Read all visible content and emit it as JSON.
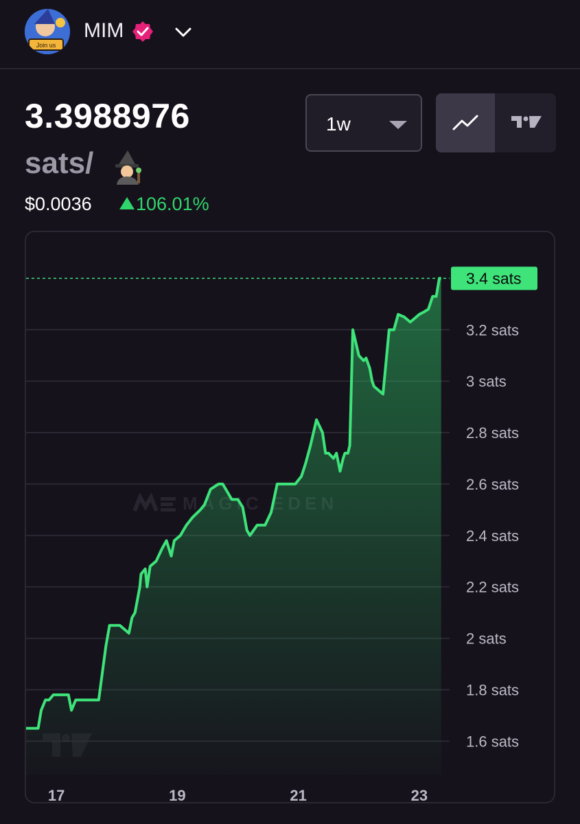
{
  "header": {
    "token_name": "MIM",
    "avatar_caption": "Join us",
    "verified_icon": "verified-badge-icon",
    "dropdown_icon": "chevron-down-icon"
  },
  "price": {
    "value": "3.3988976",
    "unit": "sats/",
    "unit_icon": "wizard-emoji-icon",
    "usd": "$0.0036",
    "change": "106.01%",
    "change_color": "#2fd66b"
  },
  "controls": {
    "timeframe": "1w",
    "line_view_icon": "line-chart-icon",
    "tradingview_icon": "tradingview-logo-icon"
  },
  "watermarks": {
    "magic_eden": "MAGIC EDEN",
    "tradingview": "TV"
  },
  "chart_data": {
    "type": "area",
    "ylim": [
      1.47,
      3.58
    ],
    "y_ticks": [
      {
        "value": 3.2,
        "label": "3.2 sats"
      },
      {
        "value": 3.0,
        "label": "3 sats"
      },
      {
        "value": 2.8,
        "label": "2.8 sats"
      },
      {
        "value": 2.6,
        "label": "2.6 sats"
      },
      {
        "value": 2.4,
        "label": "2.4 sats"
      },
      {
        "value": 2.2,
        "label": "2.2 sats"
      },
      {
        "value": 2.0,
        "label": "2 sats"
      },
      {
        "value": 1.8,
        "label": "1.8 sats"
      },
      {
        "value": 1.6,
        "label": "1.6 sats"
      }
    ],
    "x_ticks": [
      {
        "value": 17,
        "label": "17"
      },
      {
        "value": 19,
        "label": "19"
      },
      {
        "value": 21,
        "label": "21"
      },
      {
        "value": 23,
        "label": "23"
      }
    ],
    "xlim": [
      16.5,
      23.5
    ],
    "current_price": 3.4,
    "current_label": "3.4 sats",
    "line_color": "#3ee37a",
    "x": [
      16.5,
      16.7,
      16.75,
      16.82,
      16.88,
      16.95,
      17.1,
      17.2,
      17.25,
      17.32,
      17.45,
      17.7,
      17.82,
      17.88,
      17.95,
      18.05,
      18.2,
      18.25,
      18.3,
      18.38,
      18.4,
      18.47,
      18.5,
      18.55,
      18.65,
      18.75,
      18.82,
      18.9,
      18.95,
      19.05,
      19.15,
      19.25,
      19.38,
      19.45,
      19.55,
      19.68,
      19.75,
      19.9,
      20.0,
      20.08,
      20.15,
      20.2,
      20.32,
      20.45,
      20.55,
      20.65,
      20.75,
      20.8,
      20.88,
      20.95,
      21.05,
      21.12,
      21.2,
      21.3,
      21.4,
      21.45,
      21.5,
      21.58,
      21.63,
      21.69,
      21.74,
      21.77,
      21.82,
      21.85,
      21.9,
      22.0,
      22.08,
      22.12,
      22.18,
      22.22,
      22.25,
      22.3,
      22.4,
      22.5,
      22.58,
      22.65,
      22.75,
      22.85,
      22.95,
      23.0,
      23.08,
      23.15,
      23.22,
      23.28,
      23.33,
      23.36
    ],
    "values": [
      1.65,
      1.65,
      1.72,
      1.76,
      1.76,
      1.78,
      1.78,
      1.78,
      1.72,
      1.76,
      1.76,
      1.76,
      1.97,
      2.05,
      2.05,
      2.05,
      2.02,
      2.08,
      2.1,
      2.2,
      2.25,
      2.27,
      2.2,
      2.28,
      2.3,
      2.35,
      2.38,
      2.32,
      2.38,
      2.4,
      2.44,
      2.47,
      2.5,
      2.52,
      2.58,
      2.6,
      2.6,
      2.54,
      2.54,
      2.51,
      2.42,
      2.4,
      2.44,
      2.44,
      2.49,
      2.6,
      2.6,
      2.6,
      2.6,
      2.6,
      2.63,
      2.68,
      2.75,
      2.85,
      2.8,
      2.72,
      2.72,
      2.7,
      2.72,
      2.65,
      2.7,
      2.72,
      2.72,
      2.75,
      3.2,
      3.1,
      3.08,
      3.09,
      3.05,
      3.0,
      2.98,
      2.97,
      2.95,
      3.2,
      3.2,
      3.26,
      3.25,
      3.23,
      3.25,
      3.26,
      3.27,
      3.28,
      3.33,
      3.33,
      3.4,
      3.4
    ]
  }
}
